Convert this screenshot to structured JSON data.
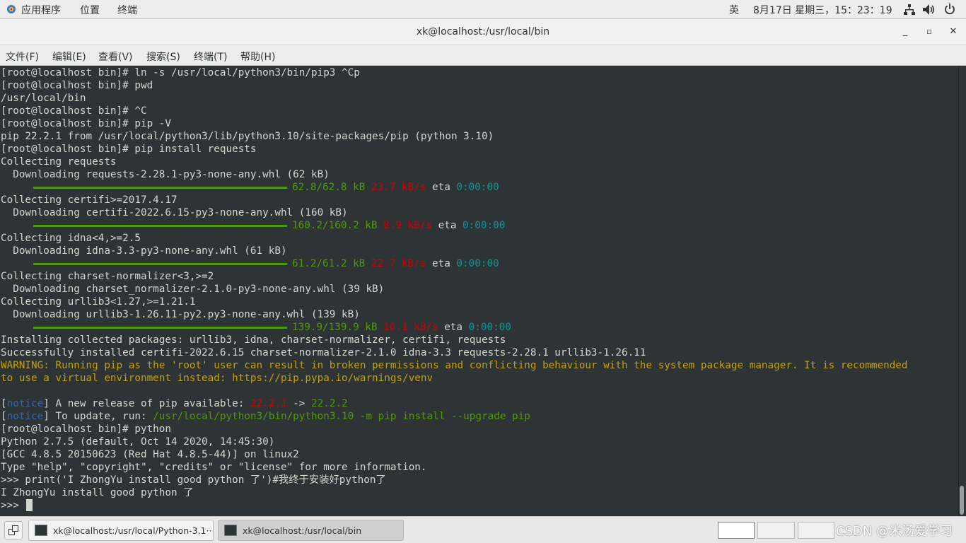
{
  "topbar": {
    "apps": "应用程序",
    "places": "位置",
    "terminal": "终端",
    "ime": "英",
    "datetime": "8月17日 星期三，15：23：19"
  },
  "window": {
    "title": "xk@localhost:/usr/local/bin",
    "minimize": "_",
    "maximize": "▫",
    "close": "✕"
  },
  "menu": {
    "file": "文件(F)",
    "edit": "编辑(E)",
    "view": "查看(V)",
    "search": "搜索(S)",
    "terminal": "终端(T)",
    "help": "帮助(H)"
  },
  "terminal": {
    "l0": "[root@localhost bin]# ln -s /usr/local/python3/bin/pip3 ^Cp",
    "l1": "[root@localhost bin]# pwd",
    "l2": "/usr/local/bin",
    "l3": "[root@localhost bin]# ^C",
    "l4": "[root@localhost bin]# pip -V",
    "l5": "pip 22.2.1 from /usr/local/python3/lib/python3.10/site-packages/pip (python 3.10)",
    "l6": "[root@localhost bin]# pip install requests",
    "l7": "Collecting requests",
    "l8": "  Downloading requests-2.28.1-py3-none-any.whl (62 kB)",
    "p1": {
      "size": "62.8/62.8 kB",
      "speed": "23.7 kB/s",
      "eta": "eta",
      "time": "0:00:00"
    },
    "l10": "Collecting certifi>=2017.4.17",
    "l11": "  Downloading certifi-2022.6.15-py3-none-any.whl (160 kB)",
    "p2": {
      "size": "160.2/160.2 kB",
      "speed": "8.9 kB/s",
      "eta": "eta",
      "time": "0:00:00"
    },
    "l13": "Collecting idna<4,>=2.5",
    "l14": "  Downloading idna-3.3-py3-none-any.whl (61 kB)",
    "p3": {
      "size": "61.2/61.2 kB",
      "speed": "22.7 kB/s",
      "eta": "eta",
      "time": "0:00:00"
    },
    "l16": "Collecting charset-normalizer<3,>=2",
    "l17": "  Downloading charset_normalizer-2.1.0-py3-none-any.whl (39 kB)",
    "l18": "Collecting urllib3<1.27,>=1.21.1",
    "l19": "  Downloading urllib3-1.26.11-py2.py3-none-any.whl (139 kB)",
    "p4": {
      "size": "139.9/139.9 kB",
      "speed": "10.1 kB/s",
      "eta": "eta",
      "time": "0:00:00"
    },
    "l21": "Installing collected packages: urllib3, idna, charset-normalizer, certifi, requests",
    "l22": "Successfully installed certifi-2022.6.15 charset-normalizer-2.1.0 idna-3.3 requests-2.28.1 urllib3-1.26.11",
    "l23": "WARNING: Running pip as the 'root' user can result in broken permissions and conflicting behaviour with the system package manager. It is recommended",
    "l24": "to use a virtual environment instead: https://pip.pypa.io/warnings/venv",
    "n1": {
      "open": "[",
      "tag": "notice",
      "close": "]",
      "text": " A new release of pip available: ",
      "old": "22.2.1",
      "arrow": " -> ",
      "new": "22.2.2"
    },
    "n2": {
      "open": "[",
      "tag": "notice",
      "close": "]",
      "text": " To update, run: ",
      "cmd": "/usr/local/python3/bin/python3.10 -m pip install --upgrade pip"
    },
    "l28": "[root@localhost bin]# python",
    "l29": "Python 2.7.5 (default, Oct 14 2020, 14:45:30)",
    "l30": "[GCC 4.8.5 20150623 (Red Hat 4.8.5-44)] on linux2",
    "l31": "Type \"help\", \"copyright\", \"credits\" or \"license\" for more information.",
    "l32": ">>> print('I ZhongYu install good python 了')#我终于安装好python了",
    "l33": "I ZhongYu install good python 了",
    "l34": ">>> "
  },
  "taskbar": {
    "task1": "xk@localhost:/usr/local/Python-3.1···",
    "task2": "xk@localhost:/usr/local/bin",
    "watermark": "CSDN @米汤爱学习"
  }
}
